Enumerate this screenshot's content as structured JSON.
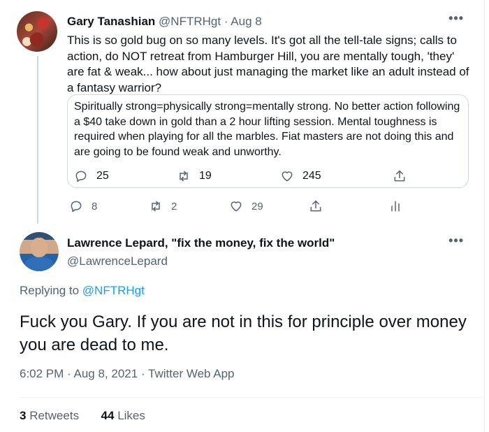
{
  "quoted_tweet": {
    "author_name": "Gary Tanashian",
    "author_handle": "@NFTRHgt",
    "date": "Aug 8",
    "text": "This is so gold bug on so many levels. It's got all the tell-tale signs; calls to action, do NOT retreat from Hamburger Hill, you are mentally tough, 'they' are fat & weak... how about just managing the market like an adult instead of a fantasy warrior?",
    "inner_quote": {
      "text": "Spiritually strong=physically strong=mentally strong.  No better action following a $40 take down in gold than a 2 hour lifting session.   Mental toughness is required when playing for all the marbles.  Fiat masters are not doing this and are going to be found weak and unworthy.",
      "replies": "25",
      "retweets": "19",
      "likes": "245"
    },
    "replies": "8",
    "retweets": "2",
    "likes": "29"
  },
  "main_tweet": {
    "author_name": "Lawrence Lepard, \"fix the money, fix the world\"",
    "author_handle": "@LawrenceLepard",
    "replying_prefix": "Replying to",
    "replying_to": "@NFTRHgt",
    "text": "Fuck you Gary.   If you are not in this for principle over money you are dead to me.",
    "time": "6:02 PM",
    "date": "Aug 8, 2021",
    "source": "Twitter Web App",
    "retweet_count": "3",
    "retweet_label": "Retweets",
    "like_count": "44",
    "like_label": "Likes"
  },
  "separators": {
    "dot": "·",
    "more": "•••"
  },
  "icons": [
    "reply-icon",
    "retweet-icon",
    "like-icon",
    "share-icon",
    "analytics-icon",
    "more-icon"
  ],
  "colors": {
    "text": "#0f1419",
    "muted": "#536471",
    "link": "#1d9bf0",
    "border": "#cfd9de"
  }
}
